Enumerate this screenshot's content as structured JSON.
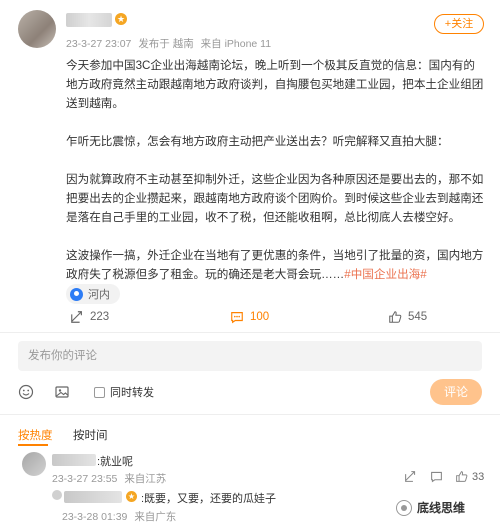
{
  "post": {
    "meta": {
      "time": "23-3-27 23:07",
      "posted_from": "发布于 越南",
      "device": "来自 iPhone 11"
    },
    "follow_label": "+关注",
    "paragraphs": [
      "今天参加中国3C企业出海越南论坛，晚上听到一个极其反直觉的信息：国内有的地方政府竟然主动跟越南地方政府谈判，自掏腰包买地建工业园，把本土企业组团送到越南。",
      "乍听无比震惊，怎会有地方政府主动把产业送出去？听完解释又直拍大腿：",
      "因为就算政府不主动甚至抑制外迁，这些企业因为各种原因还是要出去的，那不如把要出去的企业攒起来，跟越南地方政府谈个团购价。到时候这些企业去到越南还是落在自己手里的工业园，收不了税，但还能收租啊，总比彻底人去楼空好。"
    ],
    "last_paragraph": "这波操作一搞，外迁企业在当地有了更优惠的条件，当地引了批量的资，国内地方政府失了税源但多了租金。玩的确还是老大哥会玩……",
    "hashtag": "#中国企业出海#",
    "location": "河内",
    "actions": {
      "reposts": "223",
      "comments": "100",
      "likes": "545"
    }
  },
  "composer": {
    "placeholder": "发布你的评论",
    "repost_label": "同时转发",
    "submit_label": "评论"
  },
  "tabs": [
    {
      "label": "按热度",
      "active": true
    },
    {
      "label": "按时间",
      "active": false
    }
  ],
  "comments": [
    {
      "text": ":就业呢",
      "time": "23-3-27 23:55",
      "source": "来自江苏",
      "likes": "33"
    },
    {
      "text": ":既要，又要，还要的瓜娃子",
      "time": "23-3-28 01:39",
      "source": "来自广东"
    }
  ],
  "watermark": "底线思维",
  "colors": {
    "accent": "#ff8200",
    "hashtag": "#eb7350",
    "location_pin": "#2d7cf5"
  }
}
